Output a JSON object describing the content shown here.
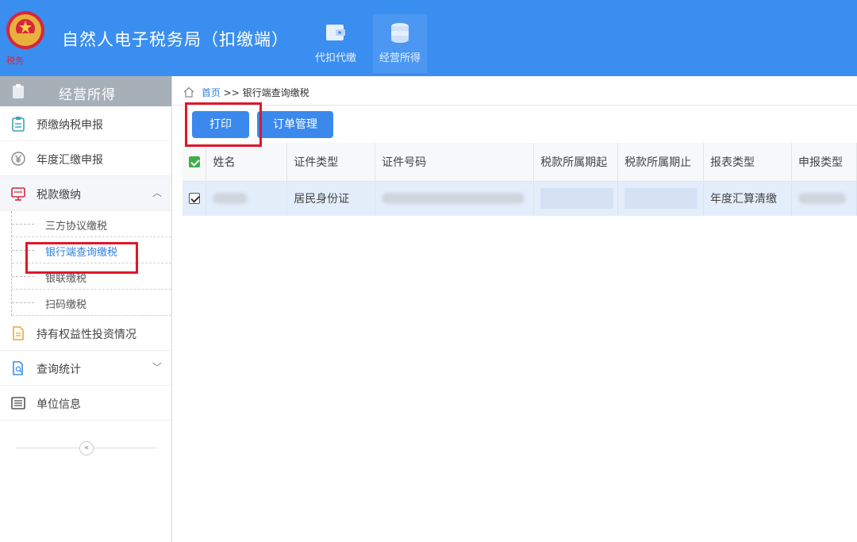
{
  "header": {
    "app_title": "自然人电子税务局（扣缴端）",
    "nav_tabs": [
      {
        "label": "代扣代缴",
        "icon": "wallet-icon"
      },
      {
        "label": "经营所得",
        "icon": "coins-icon",
        "active": true
      }
    ]
  },
  "sidebar": {
    "title": "经营所得",
    "items": [
      {
        "label": "预缴纳税申报",
        "icon": "clipboard-icon"
      },
      {
        "label": "年度汇缴申报",
        "icon": "yen-icon"
      },
      {
        "label": "税款缴纳",
        "icon": "monitor-icon",
        "expanded": true
      },
      {
        "label": "持有权益性投资情况",
        "icon": "document-icon"
      },
      {
        "label": "查询统计",
        "icon": "search-doc-icon"
      },
      {
        "label": "单位信息",
        "icon": "list-icon"
      }
    ],
    "sub_items": [
      {
        "label": "三方协议缴税"
      },
      {
        "label": "银行端查询缴税",
        "active": true
      },
      {
        "label": "银联缴税"
      },
      {
        "label": "扫码缴税"
      }
    ]
  },
  "breadcrumb": {
    "home": "首页",
    "separator": ">>",
    "current": "银行端查询缴税"
  },
  "toolbar": {
    "print_label": "打印",
    "order_label": "订单管理"
  },
  "table": {
    "columns": [
      "姓名",
      "证件类型",
      "证件号码",
      "税款所属期起",
      "税款所属期止",
      "报表类型",
      "申报类型"
    ],
    "rows": [
      {
        "id_type": "居民身份证",
        "report_type": "年度汇算清缴"
      }
    ]
  },
  "colors": {
    "header_bg": "#3a8ef0",
    "button": "#3b89ec",
    "highlight": "#e0162a"
  }
}
